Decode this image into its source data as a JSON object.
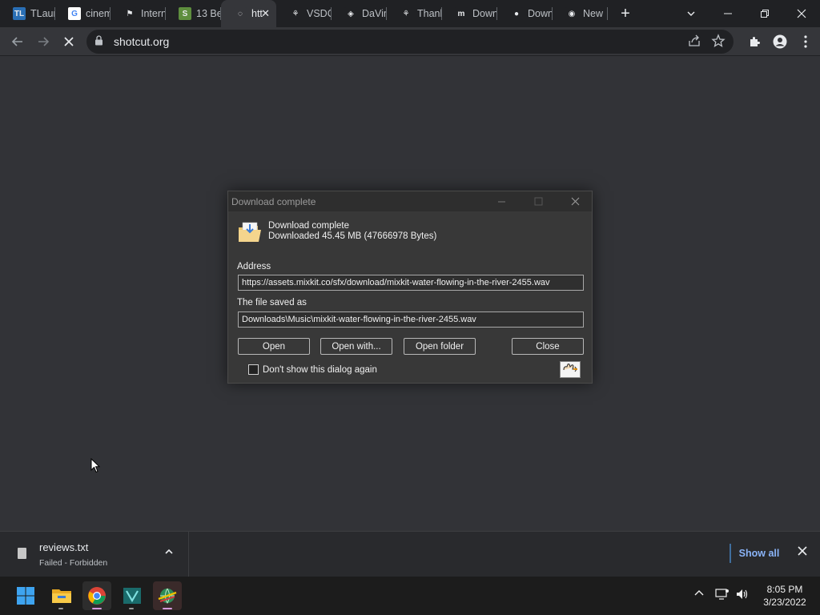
{
  "browser": {
    "tabs": [
      {
        "label": "TLaun",
        "icon": "tlauncher-icon",
        "fav_text": "TL",
        "fav_bg": "#2a6fb5"
      },
      {
        "label": "cinem",
        "icon": "google-icon",
        "fav_text": "G",
        "fav_bg": "#ffffff"
      },
      {
        "label": "Intern",
        "icon": "green-flag-icon",
        "fav_text": "⚑",
        "fav_bg": "#202124"
      },
      {
        "label": "13 Be",
        "icon": "shopify-icon",
        "fav_text": "S",
        "fav_bg": "#5e8e3e"
      },
      {
        "label": "htt",
        "icon": "loading-spinner-icon",
        "fav_text": "◌",
        "fav_bg": "#35363a",
        "active": true
      },
      {
        "label": "VSDC",
        "icon": "vsdc-icon",
        "fav_text": "⚘",
        "fav_bg": "#202124"
      },
      {
        "label": "DaVin",
        "icon": "davinci-icon",
        "fav_text": "◈",
        "fav_bg": "#202124"
      },
      {
        "label": "Thank",
        "icon": "vsdc-icon",
        "fav_text": "⚘",
        "fav_bg": "#202124"
      },
      {
        "label": "Down",
        "icon": "mixkit-icon",
        "fav_text": "m",
        "fav_bg": "#202124"
      },
      {
        "label": "Down",
        "icon": "leaf-icon",
        "fav_text": "●",
        "fav_bg": "#202124"
      },
      {
        "label": "New",
        "icon": "chrome-icon",
        "fav_text": "◉",
        "fav_bg": "#202124"
      }
    ],
    "url": "shotcut.org"
  },
  "dialog": {
    "title": "Download complete",
    "heading": "Download complete",
    "detail": "Downloaded  45.45  MB (47666978 Bytes)",
    "address_label": "Address",
    "address_value": "https://assets.mixkit.co/sfx/download/mixkit-water-flowing-in-the-river-2455.wav",
    "saved_label": "The file saved as",
    "saved_value": "Downloads\\Music\\mixkit-water-flowing-in-the-river-2455.wav",
    "open_label": "Open",
    "open_with_label": "Open with...",
    "open_folder_label": "Open folder",
    "close_label": "Close",
    "dont_show_label": "Don't show this dialog again"
  },
  "download_bar": {
    "file_name": "reviews.txt",
    "status": "Failed - Forbidden",
    "show_all_label": "Show all"
  },
  "taskbar": {
    "time": "8:05 PM",
    "date": "3/23/2022"
  },
  "colors": {
    "accent": "#8ab4f8",
    "page_bg": "#323337",
    "tabbar_bg": "#202124"
  }
}
